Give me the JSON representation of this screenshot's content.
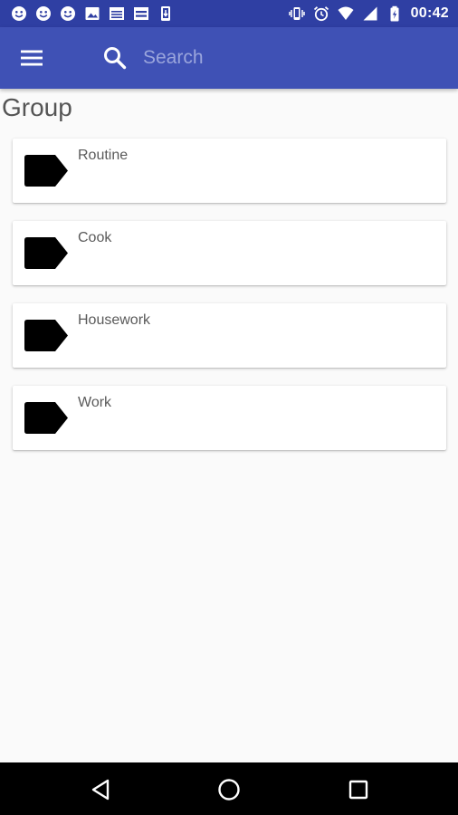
{
  "status_bar": {
    "time": "00:42",
    "left_icons": [
      "notification-face-icon",
      "notification-face-icon",
      "notification-face-icon",
      "image-icon",
      "calendar-icon",
      "calendar-icon",
      "download-icon"
    ],
    "right_icons": [
      "vibrate-icon",
      "alarm-icon",
      "wifi-icon",
      "signal-icon",
      "battery-charging-icon"
    ]
  },
  "toolbar": {
    "menu_icon": "menu-icon",
    "search_icon": "search-icon",
    "search_placeholder": "Search",
    "search_value": ""
  },
  "main": {
    "section_title": "Group",
    "groups": [
      {
        "label": "Routine",
        "icon": "label-tag-icon"
      },
      {
        "label": "Cook",
        "icon": "label-tag-icon"
      },
      {
        "label": "Housework",
        "icon": "label-tag-icon"
      },
      {
        "label": "Work",
        "icon": "label-tag-icon"
      }
    ]
  },
  "nav_bar": {
    "icons": [
      "back-icon",
      "home-icon",
      "recents-icon"
    ]
  },
  "colors": {
    "status_bar": "#2f3fa3",
    "toolbar": "#3f51b5",
    "background": "#fafafa",
    "card": "#ffffff",
    "nav_bar": "#000000"
  }
}
